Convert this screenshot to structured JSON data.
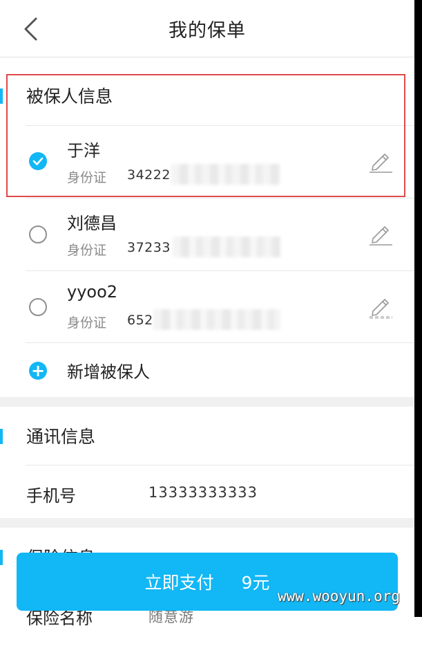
{
  "header": {
    "title": "我的保单",
    "back_icon": "chevron-left-icon"
  },
  "insured_section": {
    "title": "被保人信息",
    "people": [
      {
        "name": "于洋",
        "id_label": "身份证",
        "id_visible": "34222",
        "selected": true
      },
      {
        "name": "刘德昌",
        "id_label": "身份证",
        "id_visible": "37233",
        "selected": false
      },
      {
        "name": "yyoo2",
        "id_label": "身份证",
        "id_visible": "652",
        "selected": false
      }
    ],
    "add_label": "新增被保人"
  },
  "contact_section": {
    "title": "通讯信息",
    "phone_label": "手机号",
    "phone_value": "13333333333"
  },
  "insurance_section": {
    "title": "保险信息",
    "name_label": "保险名称",
    "name_value": "随意游"
  },
  "pay_button": {
    "label": "立即支付",
    "amount": "9元"
  },
  "watermark": "www.wooyun.org",
  "colors": {
    "accent": "#12b7f5",
    "highlight_box": "#e04848"
  }
}
